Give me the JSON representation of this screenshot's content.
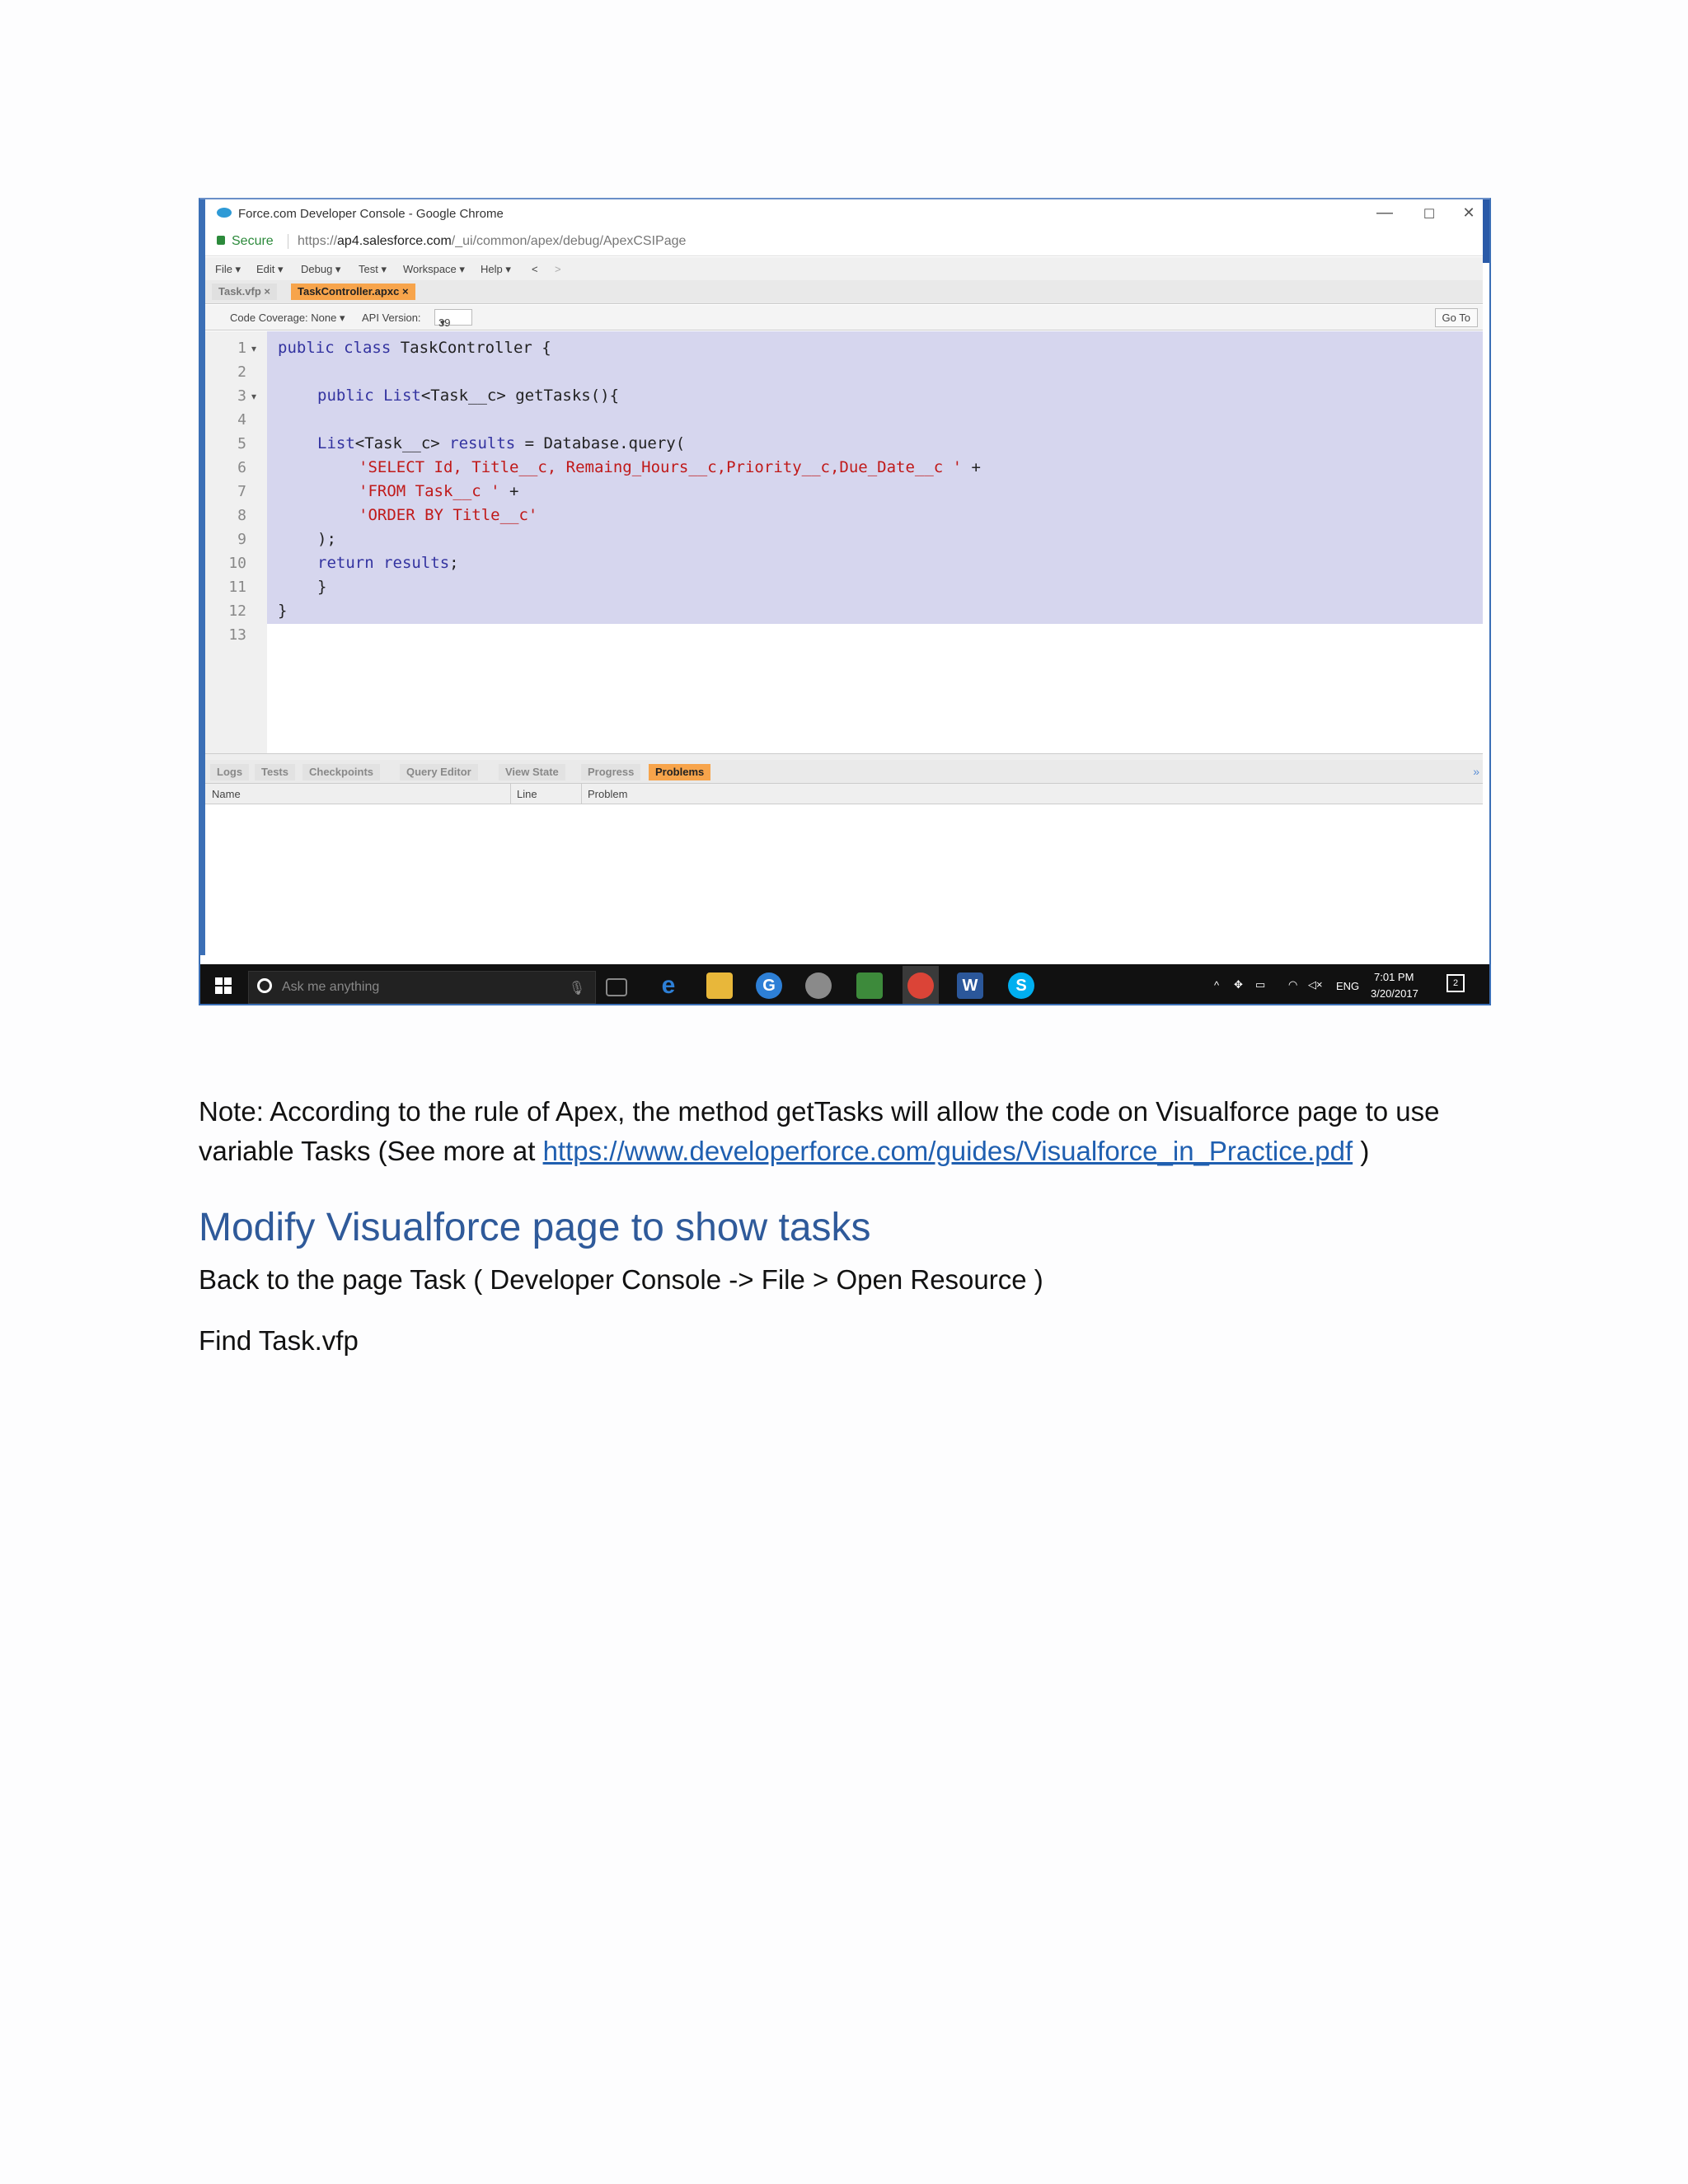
{
  "window": {
    "title": "Force.com Developer Console - Google Chrome",
    "controls": [
      "—",
      "☐",
      "✕"
    ]
  },
  "address_bar": {
    "secure_label": "Secure",
    "url_prefix": "https://",
    "url_host": "ap4.salesforce.com",
    "url_path": "/_ui/common/apex/debug/ApexCSIPage"
  },
  "menu": [
    "File ▾",
    "Edit ▾",
    "Debug ▾",
    "Test ▾",
    "Workspace ▾",
    "Help ▾",
    "<",
    ">"
  ],
  "file_tabs": [
    {
      "label": "Task.vfp",
      "close": "×"
    },
    {
      "label": "TaskController.apxc",
      "close": "×"
    }
  ],
  "toolbar": {
    "coverage": "Code Coverage: None ▾",
    "api_label": "API Version:",
    "api_value": "39",
    "goto": "Go To"
  },
  "code_lines": [
    {
      "n": "1",
      "fold": "▾"
    },
    {
      "n": "2",
      "fold": ""
    },
    {
      "n": "3",
      "fold": "▾"
    },
    {
      "n": "4",
      "fold": ""
    },
    {
      "n": "5",
      "fold": ""
    },
    {
      "n": "6",
      "fold": ""
    },
    {
      "n": "7",
      "fold": ""
    },
    {
      "n": "8",
      "fold": ""
    },
    {
      "n": "9",
      "fold": ""
    },
    {
      "n": "10",
      "fold": ""
    },
    {
      "n": "11",
      "fold": ""
    },
    {
      "n": "12",
      "fold": ""
    },
    {
      "n": "13",
      "fold": ""
    }
  ],
  "code": {
    "l1_kw": "public class",
    "l1_rest": " TaskController {",
    "l3_kw": "public List",
    "l3_rest": "<Task__c> getTasks(){",
    "l5_a": "List",
    "l5_b": "<Task__c> ",
    "l5_c": "results",
    "l5_d": " = Database.query(",
    "l6_str": "'SELECT Id, Title__c, Remaing_Hours__c,Priority__c,Due_Date__c '",
    "l6_rest": " +",
    "l7_str": "'FROM Task__c '",
    "l7_rest": " +",
    "l8_str": "'ORDER BY Title__c'",
    "l9": ");",
    "l10_kw": "return results",
    "l10_rest": ";",
    "l11": "}",
    "l12": "}"
  },
  "bottom_tabs": [
    "Logs",
    "Tests",
    "Checkpoints",
    "Query Editor",
    "View State",
    "Progress",
    "Problems"
  ],
  "problems_table": {
    "columns": [
      "Name",
      "Line",
      "Problem"
    ]
  },
  "taskbar": {
    "search_placeholder": "Ask me anything",
    "lang": "ENG",
    "time": "7:01 PM",
    "date": "3/20/2017",
    "notifications": "2"
  },
  "doc": {
    "note_text": "Note: According to the rule of Apex, the method getTasks will allow the code on Visualforce page to use variable Tasks (See more at ",
    "note_link": "https://www.developerforce.com/guides/Visualforce_in_Practice.pdf",
    "note_end": " )",
    "heading": "Modify Visualforce page to show tasks",
    "para1": "Back to the page Task ( Developer Console -> File > Open Resource )",
    "para2": "Find Task.vfp"
  },
  "colors": {
    "selection": "#d6d6ee",
    "keyword": "#3333a0",
    "string": "#c01919",
    "active_tab": "#f7a44b",
    "heading": "#2f5a9a",
    "link": "#1f5fb0"
  }
}
